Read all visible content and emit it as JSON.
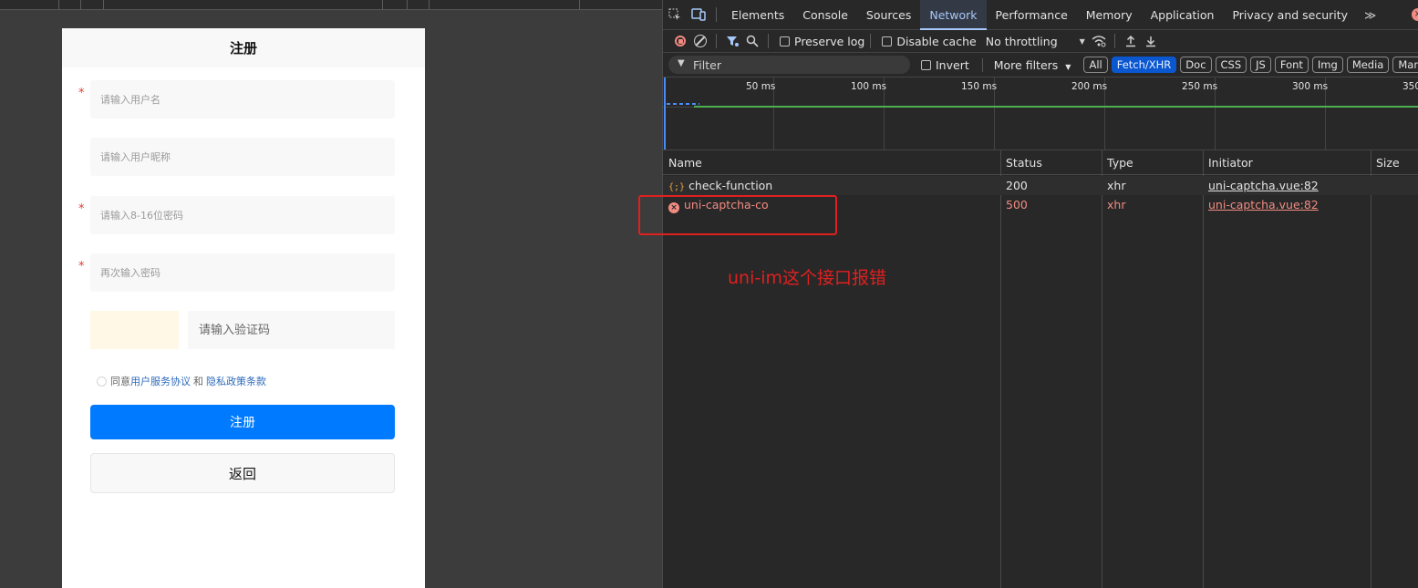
{
  "phone": {
    "title": "注册",
    "fields": [
      {
        "placeholder": "请输入用户名",
        "required": true
      },
      {
        "placeholder": "请输入用户昵称",
        "required": false
      },
      {
        "placeholder": "请输入8-16位密码",
        "required": true
      },
      {
        "placeholder": "再次输入密码",
        "required": true
      }
    ],
    "required_mark": "*",
    "captcha_placeholder": "请输入验证码",
    "agree": {
      "prefix": "同意",
      "terms": "用户服务协议",
      "sep": "和",
      "privacy": "隐私政策条款"
    },
    "register_button": "注册",
    "back_button": "返回"
  },
  "devtools": {
    "tabs": [
      "Elements",
      "Console",
      "Sources",
      "Network",
      "Performance",
      "Memory",
      "Application",
      "Privacy and security"
    ],
    "active_tab": "Network",
    "more_tabs": "≫",
    "toolbar": {
      "preserve_log": "Preserve log",
      "disable_cache": "Disable cache",
      "throttling": "No throttling"
    },
    "filterbar": {
      "filter_placeholder": "Filter",
      "invert": "Invert",
      "more_filters": "More filters",
      "chips": [
        "All",
        "Fetch/XHR",
        "Doc",
        "CSS",
        "JS",
        "Font",
        "Img",
        "Media",
        "Manif"
      ],
      "active_chip": "Fetch/XHR"
    },
    "timeline_ticks": [
      "50 ms",
      "100 ms",
      "150 ms",
      "200 ms",
      "250 ms",
      "300 ms",
      "350"
    ],
    "table": {
      "columns": [
        "Name",
        "Status",
        "Type",
        "Initiator",
        "Size"
      ],
      "rows": [
        {
          "name": "check-function",
          "status": "200",
          "type": "xhr",
          "initiator": "uni-captcha.vue:82",
          "error": false
        },
        {
          "name": "uni-captcha-co",
          "status": "500",
          "type": "xhr",
          "initiator": "uni-captcha.vue:82",
          "error": true
        }
      ]
    },
    "colors": {
      "accent": "#a8c7fa",
      "error": "#f28b82",
      "annotation": "#e02020"
    }
  },
  "annotation": "uni-im这个接口报错"
}
